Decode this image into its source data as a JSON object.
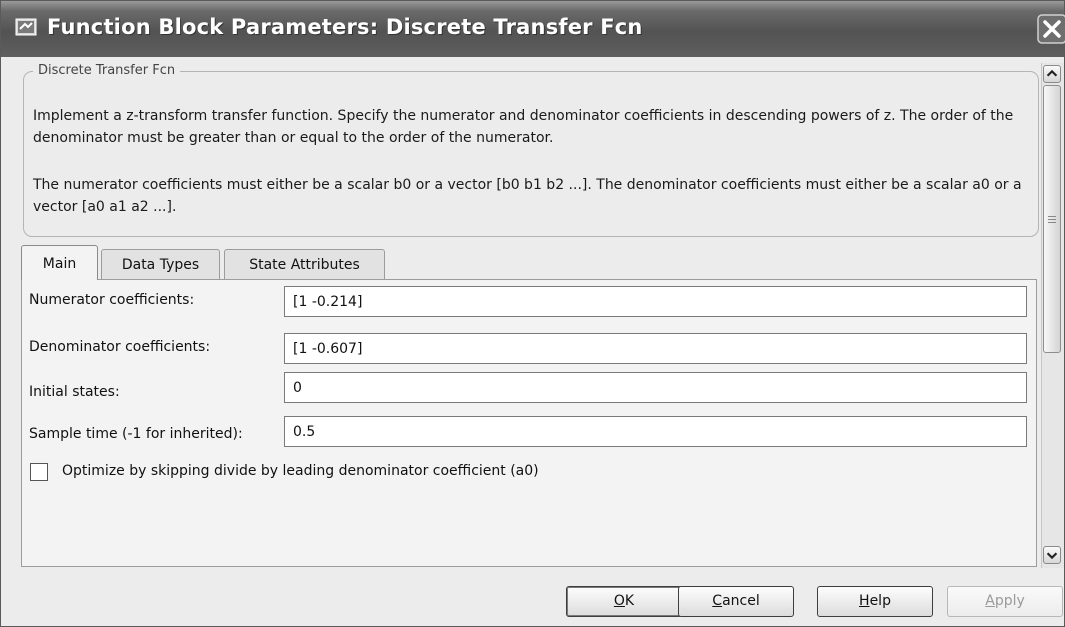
{
  "window": {
    "title": "Function Block Parameters: Discrete Transfer Fcn",
    "app_icon": "simulink-block-icon",
    "close_icon": "close-icon"
  },
  "description": {
    "legend": "Discrete Transfer Fcn",
    "paragraph1": "Implement a z-transform transfer function. Specify the numerator and denominator coefficients in descending powers of z. The order of the denominator must be greater than or equal to the order of the numerator.",
    "paragraph2": "The numerator coefficients must either be a scalar b0 or a vector [b0 b1 b2 ...]. The denominator coefficients must either be a scalar a0 or a vector [a0 a1 a2 ...]."
  },
  "tabs": [
    {
      "label": "Main",
      "active": true
    },
    {
      "label": "Data Types",
      "active": false
    },
    {
      "label": "State Attributes",
      "active": false
    }
  ],
  "fields": [
    {
      "label": "Numerator coefficients:",
      "value": "[1 -0.214]"
    },
    {
      "label": "Denominator coefficients:",
      "value": "[1 -0.607]"
    },
    {
      "label": "Initial states:",
      "value": "0"
    },
    {
      "label": "Sample time (-1 for inherited):",
      "value": "0.5"
    }
  ],
  "checkbox": {
    "label": "Optimize by skipping divide by leading denominator coefficient (a0)",
    "checked": false
  },
  "buttons": {
    "ok": {
      "prefix": "",
      "mnemonic": "O",
      "rest": "K"
    },
    "cancel": {
      "prefix": "",
      "mnemonic": "C",
      "rest": "ancel"
    },
    "help": {
      "prefix": "",
      "mnemonic": "H",
      "rest": "elp"
    },
    "apply": {
      "prefix": "",
      "mnemonic": "A",
      "rest": "pply",
      "enabled": false
    }
  },
  "colors": {
    "titlebar": "#535353",
    "window_bg": "#ececec",
    "panel_bg": "#f3f3f3"
  }
}
